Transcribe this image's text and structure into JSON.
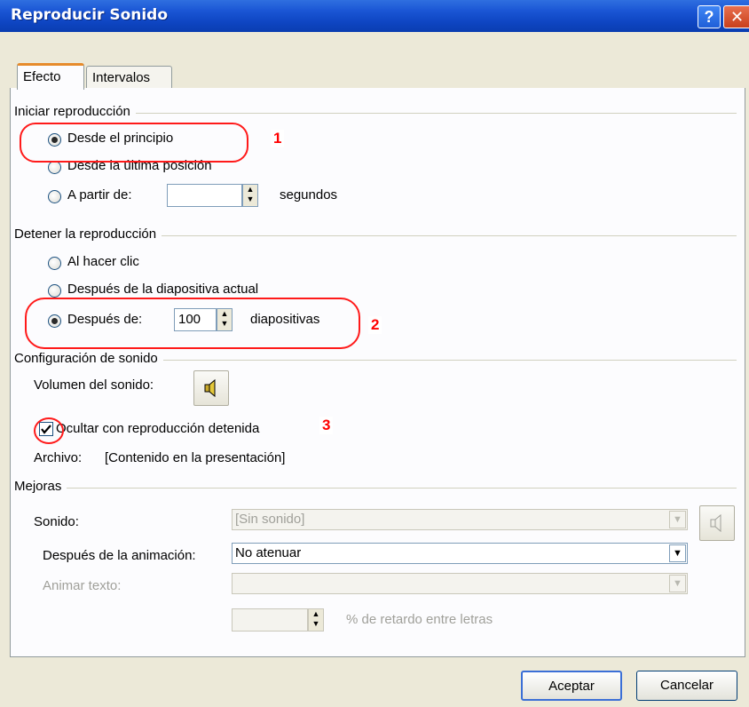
{
  "window": {
    "title": "Reproducir Sonido",
    "help_icon": "?",
    "close_icon": "✕"
  },
  "tabs": [
    {
      "label": "Efecto",
      "active": true
    },
    {
      "label": "Intervalos",
      "active": false
    }
  ],
  "start": {
    "legend": "Iniciar reproducción",
    "options": [
      "Desde el principio",
      "Desde la última posición",
      "A partir de:"
    ],
    "selected": 0,
    "from_value": "",
    "from_unit": "segundos"
  },
  "stop": {
    "legend": "Detener la reproducción",
    "options": [
      "Al hacer clic",
      "Después de la diapositiva actual",
      "Después de:"
    ],
    "selected": 2,
    "after_value": "100",
    "after_unit": "diapositivas"
  },
  "sound_settings": {
    "legend": "Configuración de sonido",
    "volume_label": "Volumen del sonido:",
    "volume_icon": "speaker-icon",
    "hide_label": "Ocultar con reproducción detenida",
    "hide_checked": true,
    "file_label": "Archivo:",
    "file_value": "[Contenido en la presentación]"
  },
  "enhancements": {
    "legend": "Mejoras",
    "sound_label": "Sonido:",
    "sound_value": "[Sin sonido]",
    "after_anim_label": "Después de la animación:",
    "after_anim_value": "No atenuar",
    "animate_text_label": "Animar texto:",
    "animate_text_value": "",
    "delay_value": "",
    "delay_label": "% de retardo entre letras"
  },
  "buttons": {
    "ok": "Aceptar",
    "cancel": "Cancelar"
  },
  "annotations": [
    "1",
    "2",
    "3"
  ],
  "colors": {
    "titlebar": "#0a3db0",
    "annotation": "#ff0000",
    "dialog_bg": "#ece9d8"
  }
}
